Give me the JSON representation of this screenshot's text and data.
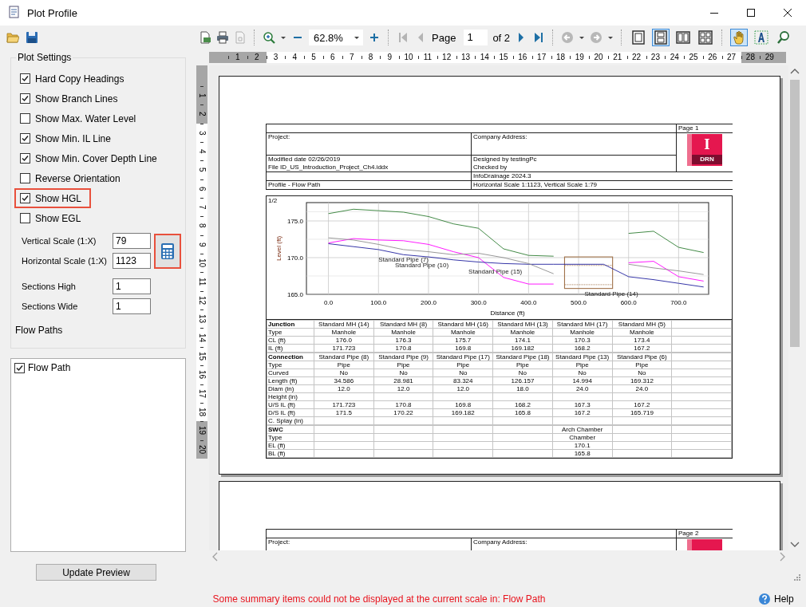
{
  "window": {
    "title": "Plot Profile"
  },
  "plot_settings": {
    "title": "Plot Settings",
    "options": [
      {
        "label": "Hard Copy Headings",
        "checked": true,
        "highlighted": false
      },
      {
        "label": "Show Branch Lines",
        "checked": true,
        "highlighted": false
      },
      {
        "label": "Show Max. Water Level",
        "checked": false,
        "highlighted": false
      },
      {
        "label": "Show Min. IL Line",
        "checked": true,
        "highlighted": false
      },
      {
        "label": "Show Min. Cover Depth Line",
        "checked": true,
        "highlighted": false
      },
      {
        "label": "Reverse Orientation",
        "checked": false,
        "highlighted": false
      },
      {
        "label": "Show HGL",
        "checked": true,
        "highlighted": true
      },
      {
        "label": "Show EGL",
        "checked": false,
        "highlighted": false
      }
    ],
    "scale_fields": [
      {
        "label": "Vertical Scale (1:X)",
        "value": "79"
      },
      {
        "label": "Horizontal Scale (1:X)",
        "value": "1123"
      }
    ],
    "calculator": {
      "highlighted": true
    },
    "section_fields": [
      {
        "label": "Sections High",
        "value": "1"
      },
      {
        "label": "Sections Wide",
        "value": "1"
      }
    ],
    "flow_paths_label": "Flow Paths"
  },
  "flow_paths": [
    {
      "label": "Flow Path",
      "checked": true
    }
  ],
  "update_button": "Update Preview",
  "toolbar": {
    "zoom": "62.8%",
    "page_label": "Page",
    "page": "1",
    "page_count": "of 2",
    "nav": [
      {
        "kind": "first",
        "disabled": true
      },
      {
        "kind": "prev",
        "disabled": true
      },
      {
        "kind": "next",
        "disabled": false
      },
      {
        "kind": "last",
        "disabled": false
      }
    ],
    "view_modes": [
      {
        "kind": "single",
        "selected": false
      },
      {
        "kind": "continuous",
        "selected": true
      },
      {
        "kind": "facing",
        "selected": false
      },
      {
        "kind": "grid",
        "selected": false
      }
    ],
    "tools": [
      {
        "kind": "hand",
        "selected": true
      },
      {
        "kind": "text",
        "selected": false
      },
      {
        "kind": "zoom",
        "selected": false
      }
    ]
  },
  "ruler_h": [
    {
      "label": "1",
      "margin": true
    },
    {
      "label": "2",
      "margin": true
    },
    {
      "label": "3",
      "margin": false
    },
    {
      "label": "4",
      "margin": false
    },
    {
      "label": "5",
      "margin": false
    },
    {
      "label": "6",
      "margin": false
    },
    {
      "label": "7",
      "margin": false
    },
    {
      "label": "8",
      "margin": false
    },
    {
      "label": "9",
      "margin": false
    },
    {
      "label": "10",
      "margin": false
    },
    {
      "label": "11",
      "margin": false
    },
    {
      "label": "12",
      "margin": false
    },
    {
      "label": "13",
      "margin": false
    },
    {
      "label": "14",
      "margin": false
    },
    {
      "label": "15",
      "margin": false
    },
    {
      "label": "16",
      "margin": false
    },
    {
      "label": "17",
      "margin": false
    },
    {
      "label": "18",
      "margin": false
    },
    {
      "label": "19",
      "margin": false
    },
    {
      "label": "20",
      "margin": false
    },
    {
      "label": "21",
      "margin": false
    },
    {
      "label": "22",
      "margin": false
    },
    {
      "label": "23",
      "margin": false
    },
    {
      "label": "24",
      "margin": false
    },
    {
      "label": "25",
      "margin": false
    },
    {
      "label": "26",
      "margin": false
    },
    {
      "label": "27",
      "margin": false
    },
    {
      "label": "28",
      "margin": true
    },
    {
      "label": "29",
      "margin": true
    }
  ],
  "ruler_v": [
    {
      "label": "1",
      "margin": true
    },
    {
      "label": "2",
      "margin": true
    },
    {
      "label": "3",
      "margin": false
    },
    {
      "label": "4",
      "margin": false
    },
    {
      "label": "5",
      "margin": false
    },
    {
      "label": "6",
      "margin": false
    },
    {
      "label": "7",
      "margin": false
    },
    {
      "label": "8",
      "margin": false
    },
    {
      "label": "9",
      "margin": false
    },
    {
      "label": "10",
      "margin": false
    },
    {
      "label": "11",
      "margin": false
    },
    {
      "label": "12",
      "margin": false
    },
    {
      "label": "13",
      "margin": false
    },
    {
      "label": "14",
      "margin": false
    },
    {
      "label": "15",
      "margin": false
    },
    {
      "label": "16",
      "margin": false
    },
    {
      "label": "17",
      "margin": false
    },
    {
      "label": "18",
      "margin": false
    },
    {
      "label": "19",
      "margin": true
    },
    {
      "label": "20",
      "margin": true
    }
  ],
  "pages": [
    {
      "header": {
        "page": "Page 1",
        "project": "Project:",
        "company": "Company Address:",
        "modified": "Modified date 02/26/2019",
        "file": "File ID_US_Introduction_Project_Ch4.iddx",
        "designed": "Designed by testingPc",
        "checked_by": "Checked by",
        "software": "InfoDrainage 2024.3",
        "profile": "Profile - Flow Path",
        "scale": "Horizontal Scale 1:1123, Vertical Scale 1:79",
        "logo": {
          "kind": "tile",
          "letter": "I",
          "label": "DRN"
        }
      },
      "chart": {
        "corner": "1/2",
        "chart_data": {
          "type": "line",
          "xlabel": "Distance (ft)",
          "ylabel": "Level (ft)",
          "x": [
            0,
            50,
            100,
            150,
            200,
            250,
            300,
            350,
            400,
            450,
            500,
            550,
            600,
            650,
            700,
            750
          ],
          "series": [
            {
              "color": "#2e7d32",
              "values": [
                176.0,
                176.6,
                176.4,
                176.2,
                175.6,
                174.6,
                174.0,
                171.2,
                170.3,
                170.2,
                null,
                null,
                173.3,
                173.6,
                171.4,
                170.7
              ]
            },
            {
              "color": "#ff00ff",
              "values": [
                172.0,
                172.6,
                172.4,
                172.3,
                171.8,
                170.8,
                170.0,
                167.3,
                166.4,
                166.4,
                null,
                null,
                169.3,
                169.5,
                167.4,
                166.8
              ]
            },
            {
              "color": "#1f1f9e",
              "values": [
                171.9,
                171.5,
                171.1,
                170.4,
                170.1,
                169.7,
                169.4,
                169.2,
                169.1,
                169.1,
                169.1,
                169.1,
                167.4,
                167.0,
                166.5,
                166.0
              ]
            },
            {
              "color": "#8c8c8c",
              "values": [
                172.7,
                172.4,
                171.8,
                171.1,
                170.8,
                170.4,
                170.6,
                170.0,
                169.2,
                167.8,
                null,
                null,
                169.1,
                168.6,
                168.2,
                167.7
              ]
            }
          ],
          "xlim": [
            -44,
            760
          ],
          "ylim": [
            165,
            177.5
          ],
          "xticks": [
            {
              "value": 0,
              "label": "0.0"
            },
            {
              "value": 100,
              "label": "100.0"
            },
            {
              "value": 200,
              "label": "200.0"
            },
            {
              "value": 300,
              "label": "300.0"
            },
            {
              "value": 400,
              "label": "400.0"
            },
            {
              "value": 500,
              "label": "500.0"
            },
            {
              "value": 600,
              "label": "600.0"
            },
            {
              "value": 700,
              "label": "700.0"
            }
          ],
          "yticks": [
            {
              "value": 165,
              "label": "165.0"
            },
            {
              "value": 170,
              "label": "170.0"
            },
            {
              "value": 175,
              "label": "175.0"
            }
          ],
          "grid": true,
          "annotations": [
            "Standard Pipe (7)",
            "Standard Pipe (10)",
            "Standard Pipe (15)",
            "Standard Pipe (14)"
          ]
        }
      },
      "table": {
        "sections": [
          {
            "kind": "grid",
            "title": "Junction",
            "headers": [
              "Standard MH (14)",
              "Standard MH (8)",
              "Standard MH (16)",
              "Standard MH (13)",
              "Standard MH (17)",
              "Standard MH (5)"
            ],
            "rows": [
              {
                "label": "Type",
                "cells": [
                  "Manhole",
                  "Manhole",
                  "Manhole",
                  "Manhole",
                  "Manhole",
                  "Manhole"
                ]
              },
              {
                "label": "CL (ft)",
                "cells": [
                  "176.0",
                  "176.3",
                  "175.7",
                  "174.1",
                  "170.3",
                  "173.4"
                ]
              },
              {
                "label": "IL (ft)",
                "cells": [
                  "171.723",
                  "170.8",
                  "169.8",
                  "169.182",
                  "168.2",
                  "167.2"
                ]
              }
            ]
          },
          {
            "kind": "grid",
            "title": "Connection",
            "headers": [
              "Standard Pipe (8)",
              "Standard Pipe (9)",
              "Standard Pipe (17)",
              "Standard Pipe (18)",
              "Standard Pipe (13)",
              "Standard Pipe (6)"
            ],
            "rows": [
              {
                "label": "Type",
                "cells": [
                  "Pipe",
                  "Pipe",
                  "Pipe",
                  "Pipe",
                  "Pipe",
                  "Pipe"
                ]
              },
              {
                "label": "Curved",
                "cells": [
                  "No",
                  "No",
                  "No",
                  "No",
                  "No",
                  "No"
                ]
              },
              {
                "label": "Length (ft)",
                "cells": [
                  "34.586",
                  "28.981",
                  "83.324",
                  "126.157",
                  "14.994",
                  "169.312"
                ]
              },
              {
                "label": "Diam (in)",
                "cells": [
                  "12.0",
                  "12.0",
                  "12.0",
                  "18.0",
                  "24.0",
                  "24.0"
                ]
              },
              {
                "label": "Height (in)"
              },
              {
                "label": "U/S IL (ft)",
                "cells": [
                  "171.723",
                  "170.8",
                  "169.8",
                  "168.2",
                  "167.3",
                  "167.2"
                ]
              },
              {
                "label": "D/S IL (ft)",
                "cells": [
                  "171.5",
                  "170.22",
                  "169.182",
                  "165.8",
                  "167.2",
                  "165.719"
                ]
              },
              {
                "label": "C. Splay (in)"
              }
            ]
          },
          {
            "kind": "single",
            "title": "SWC",
            "headers": [
              "Arch Chamber"
            ],
            "rows": [
              {
                "label": "Type",
                "cells": [
                  "Chamber"
                ]
              },
              {
                "label": "EL (ft)",
                "cells": [
                  "170.1"
                ]
              },
              {
                "label": "BL (ft)",
                "cells": [
                  "165.8"
                ]
              }
            ]
          }
        ]
      }
    },
    {
      "header": {
        "page": "Page 2",
        "project": "Project:",
        "company": "Company Address:",
        "logo": {
          "kind": "tile"
        }
      }
    }
  ],
  "status": {
    "message": "Some summary items could not be displayed at the current scale in: Flow Path",
    "help": "Help"
  }
}
